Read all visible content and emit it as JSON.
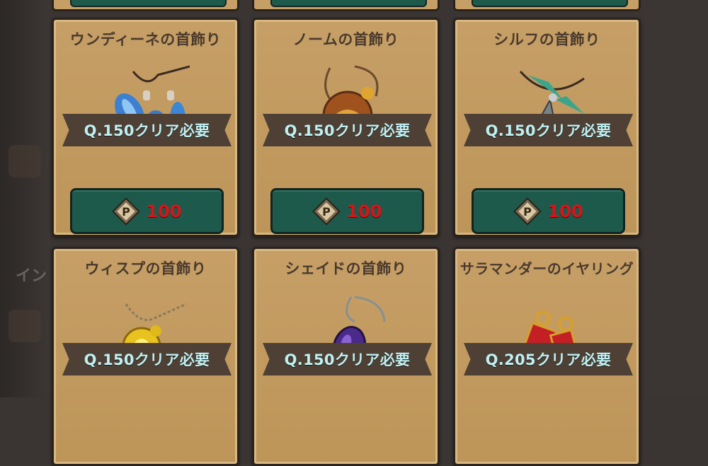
{
  "colors": {
    "card_bg": "#c69f67",
    "card_border": "#2a221d",
    "button_green": "#1e5a4b",
    "price_red": "#d8141a",
    "requirement_text": "#bff0f3",
    "title_text": "#4a3a2c"
  },
  "background": {
    "partial_text": "イン"
  },
  "items": [
    {
      "name": "ウンディーネの首飾り",
      "icon": "undine-necklace-icon",
      "requirement": "Q.150クリア必要",
      "price_icon": "point-coin-icon",
      "price": "100"
    },
    {
      "name": "ノームの首飾り",
      "icon": "gnome-necklace-icon",
      "requirement": "Q.150クリア必要",
      "price_icon": "point-coin-icon",
      "price": "100"
    },
    {
      "name": "シルフの首飾り",
      "icon": "sylph-necklace-icon",
      "requirement": "Q.150クリア必要",
      "price_icon": "point-coin-icon",
      "price": "100"
    },
    {
      "name": "ウィスプの首飾り",
      "icon": "wisp-necklace-icon",
      "requirement": "Q.150クリア必要"
    },
    {
      "name": "シェイドの首飾り",
      "icon": "shade-necklace-icon",
      "requirement": "Q.150クリア必要"
    },
    {
      "name": "サラマンダーのイヤリング",
      "icon": "salamander-earring-icon",
      "requirement": "Q.205クリア必要"
    }
  ]
}
